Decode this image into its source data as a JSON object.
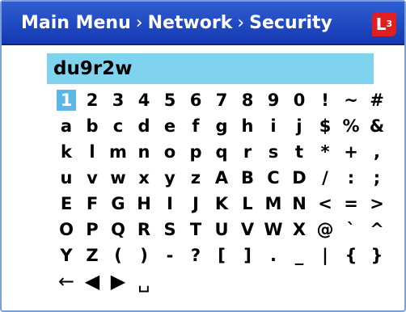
{
  "breadcrumb": {
    "items": [
      "Main Menu",
      "Network",
      "Security"
    ],
    "separator": "›"
  },
  "logo": {
    "text": "L",
    "sub": "3",
    "color": "#e02020"
  },
  "input": {
    "value": "du9r2w"
  },
  "keyboard": {
    "selected_key": "1",
    "rows": [
      [
        "1",
        "2",
        "3",
        "4",
        "5",
        "6",
        "7",
        "8",
        "9",
        "0",
        "!",
        "~",
        "#"
      ],
      [
        "a",
        "b",
        "c",
        "d",
        "e",
        "f",
        "g",
        "h",
        "i",
        "j",
        "$",
        "%",
        "&"
      ],
      [
        "k",
        "l",
        "m",
        "n",
        "o",
        "p",
        "q",
        "r",
        "s",
        "t",
        "*",
        "+",
        ","
      ],
      [
        "u",
        "v",
        "w",
        "x",
        "y",
        "z",
        "A",
        "B",
        "C",
        "D",
        "/",
        ":",
        ";"
      ],
      [
        "E",
        "F",
        "G",
        "H",
        "I",
        "J",
        "K",
        "L",
        "M",
        "N",
        "<",
        "=",
        ">"
      ],
      [
        "O",
        "P",
        "Q",
        "R",
        "S",
        "T",
        "U",
        "V",
        "W",
        "X",
        "@",
        "`",
        "^"
      ],
      [
        "Y",
        "Z",
        "(",
        ")",
        "-",
        "?",
        "[",
        "]",
        ".",
        "_",
        "|",
        "{",
        "}"
      ]
    ],
    "control_keys": [
      {
        "name": "backspace-key",
        "glyph": "←",
        "icon": "backspace-arrow-icon"
      },
      {
        "name": "cursor-left-key",
        "glyph": "◀",
        "icon": "triangle-left-icon"
      },
      {
        "name": "cursor-right-key",
        "glyph": "▶",
        "icon": "triangle-right-icon"
      },
      {
        "name": "space-key",
        "glyph": "␣",
        "icon": "space-bar-icon"
      }
    ]
  },
  "colors": {
    "title_bar": "#1f46c4",
    "input_background": "#7fd3ef",
    "selected_key": "#5bb8e6"
  }
}
